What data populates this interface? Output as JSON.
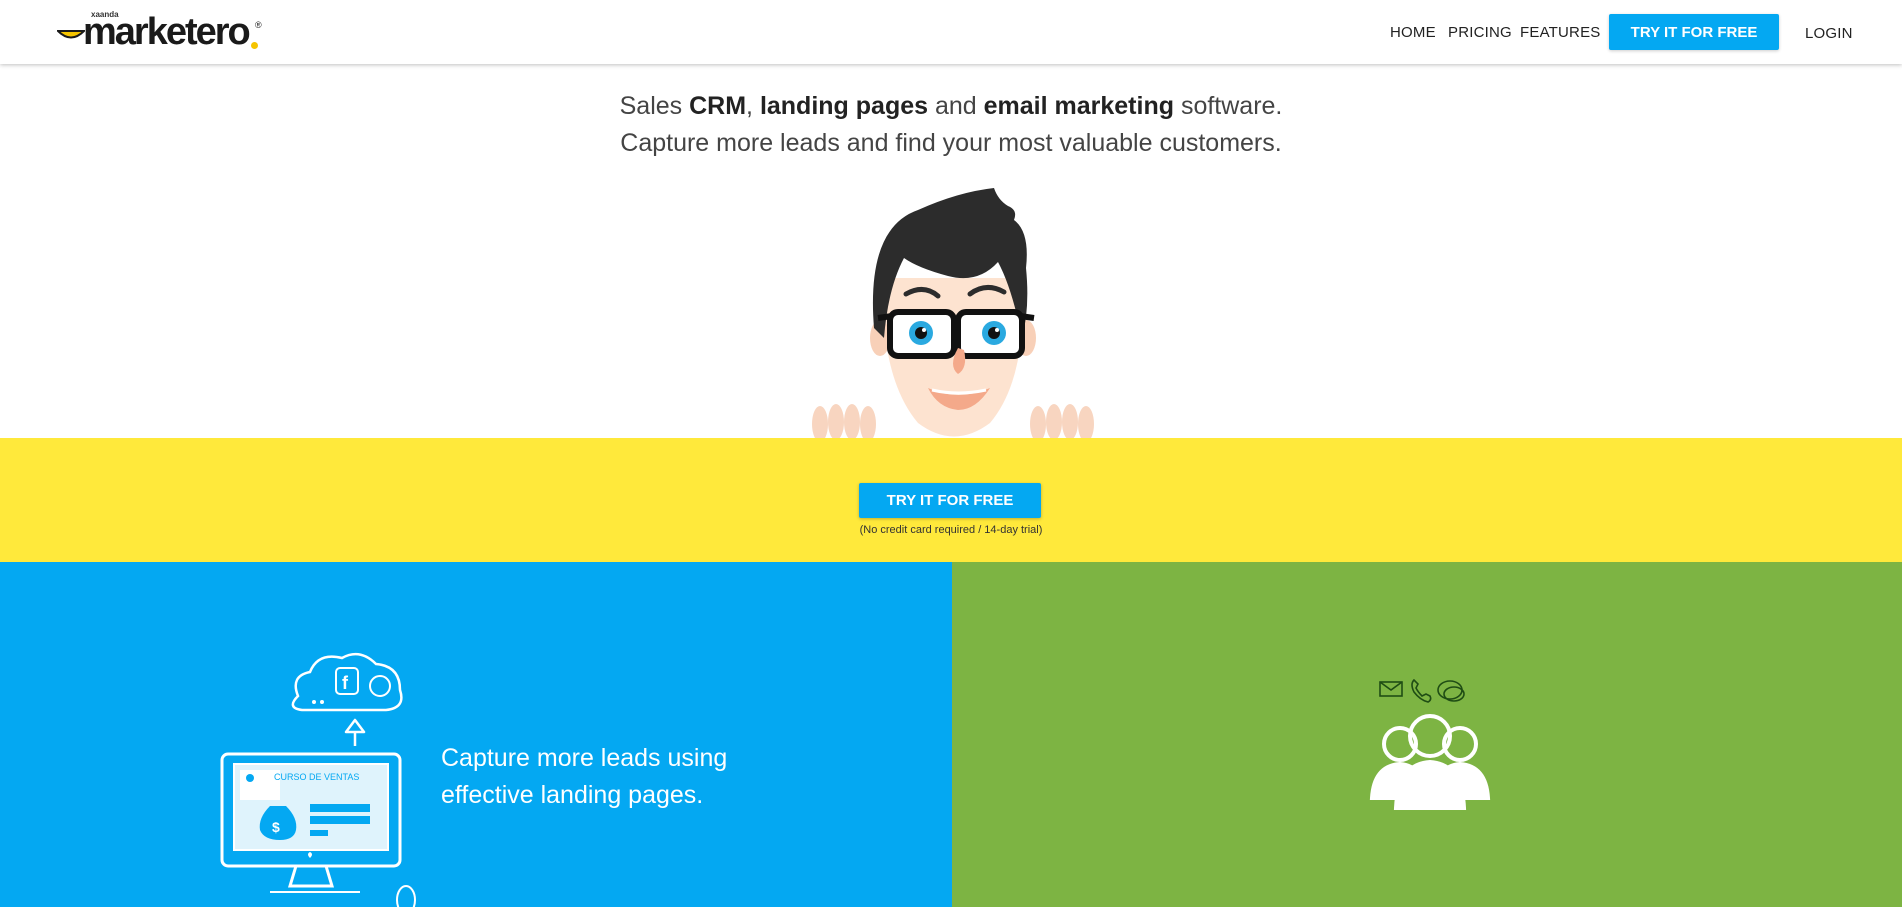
{
  "header": {
    "logo_text": "marketero",
    "logo_brand": "xaanda",
    "logo_reg": "®",
    "nav": {
      "home": "HOME",
      "pricing": "PRICING",
      "features": "FEATURES",
      "cta": "TRY IT FOR FREE",
      "login": "LOGIN"
    }
  },
  "hero": {
    "line1": {
      "p1": "Sales ",
      "b1": "CRM",
      "p2": ", ",
      "b2": "landing pages",
      "p3": " and ",
      "b3": "email marketing",
      "p4": " software."
    },
    "line2": "Capture more leads and find your most valuable customers."
  },
  "band": {
    "cta": "TRY IT FOR FREE",
    "note": "(No credit card required / 14-day trial)"
  },
  "feature_blue": {
    "line1": "Capture more leads using",
    "line2": "effective landing pages.",
    "screen_title": "CURSO DE VENTAS"
  },
  "colors": {
    "accent_blue": "#04a8f2",
    "band_yellow": "#ffe93b",
    "panel_green": "#7db443"
  },
  "icons": [
    "mascot-illustration",
    "facebook-icon",
    "globe-icon",
    "cloud-icon",
    "upload-arrow-icon",
    "money-bag-icon",
    "mail-icon",
    "phone-icon",
    "chat-icon",
    "people-group-icon"
  ]
}
